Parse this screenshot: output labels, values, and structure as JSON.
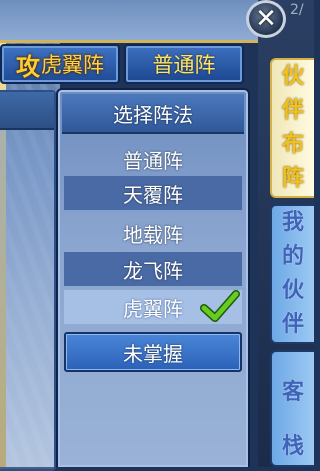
{
  "formation_tabs": {
    "active": {
      "prefix": "攻",
      "label": "虎翼阵"
    },
    "secondary": {
      "label": "普通阵"
    }
  },
  "close": {
    "icon": "close-icon",
    "glyph": "✕"
  },
  "corner_text": "2/",
  "dropdown": {
    "title": "选择阵法",
    "items": [
      {
        "label": "普通阵",
        "state": "available"
      },
      {
        "label": "天覆阵",
        "state": "available"
      },
      {
        "label": "地载阵",
        "state": "available"
      },
      {
        "label": "龙飞阵",
        "state": "available"
      },
      {
        "label": "虎翼阵",
        "state": "selected"
      },
      {
        "label": "未掌握",
        "state": "locked"
      }
    ]
  },
  "side_tabs": [
    {
      "chars": [
        "伙",
        "伴",
        "布",
        "阵"
      ],
      "active": true
    },
    {
      "chars": [
        "我",
        "的",
        "伙",
        "伴"
      ],
      "active": false
    },
    {
      "chars": [
        "客",
        "栈"
      ],
      "active": false
    }
  ],
  "colors": {
    "accent_gold": "#ffd24a",
    "check_green": "#4fb31e",
    "panel_blue": "#2f5899"
  }
}
